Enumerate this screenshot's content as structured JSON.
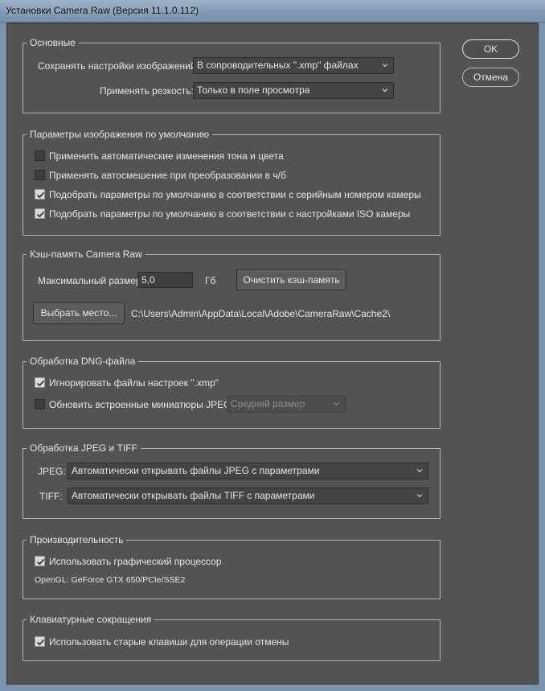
{
  "window": {
    "title": "Установки Camera Raw  (Версия 11.1.0.112)"
  },
  "buttons": {
    "ok": "OK",
    "cancel": "Отмена"
  },
  "general": {
    "title": "Основные",
    "save_settings_label": "Сохранять настройки изображений:",
    "save_settings_value": "В сопроводительных \".xmp\" файлах",
    "sharpen_label": "Применять резкость:",
    "sharpen_value": "Только в поле просмотра"
  },
  "defaults": {
    "title": "Параметры изображения по умолчанию",
    "items": [
      {
        "label": "Применить автоматические изменения тона и цвета",
        "checked": false
      },
      {
        "label": "Применять автосмешение при преобразовании в ч/б",
        "checked": false
      },
      {
        "label": "Подобрать параметры по умолчанию в соответствии с серийным номером камеры",
        "checked": true
      },
      {
        "label": "Подобрать параметры по умолчанию в соответствии с настройками ISO камеры",
        "checked": true
      }
    ]
  },
  "cache": {
    "title": "Кэш-память Camera Raw",
    "max_size_label": "Максимальный размер:",
    "max_size_value": "5,0",
    "unit": "Гб",
    "purge_button": "Очистить кэш-память",
    "select_location_button": "Выбрать место...",
    "path": "C:\\Users\\Admin\\AppData\\Local\\Adobe\\CameraRaw\\Cache2\\"
  },
  "dng": {
    "title": "Обработка DNG-файла",
    "ignore_xmp_label": "Игнорировать файлы настроек \".xmp\"",
    "ignore_xmp_checked": true,
    "update_previews_label": "Обновить встроенные миниатюры JPEG:",
    "update_previews_checked": false,
    "preview_size_value": "Средний размер"
  },
  "jpeg_tiff": {
    "title": "Обработка JPEG и TIFF",
    "jpeg_label": "JPEG:",
    "jpeg_value": "Автоматически открывать файлы JPEG с параметрами",
    "tiff_label": "TIFF:",
    "tiff_value": "Автоматически открывать файлы TIFF с параметрами"
  },
  "performance": {
    "title": "Производительность",
    "gpu_label": "Использовать графический процессор",
    "gpu_checked": true,
    "gpu_info": "OpenGL: GeForce GTX 650/PCIe/SSE2"
  },
  "shortcuts": {
    "title": "Клавиатурные сокращения",
    "legacy_undo_label": "Использовать старые клавиши для операции отмены",
    "legacy_undo_checked": true
  },
  "colors": {
    "panel": "#535353",
    "frame": "#7c93ad",
    "text": "#e6e6e6"
  }
}
